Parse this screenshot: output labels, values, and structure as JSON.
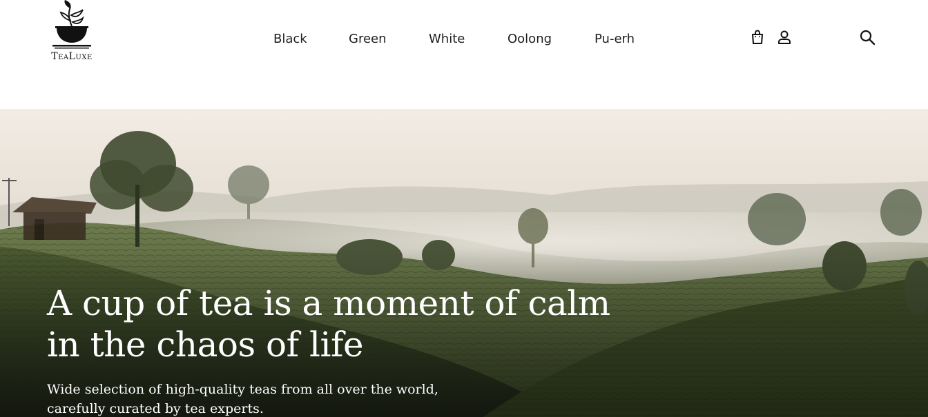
{
  "brand": {
    "name": "TeaLuxe"
  },
  "nav": {
    "items": [
      {
        "label": "Black"
      },
      {
        "label": "Green"
      },
      {
        "label": "White"
      },
      {
        "label": "Oolong"
      },
      {
        "label": "Pu-erh"
      }
    ]
  },
  "icons": {
    "cart": "shopping-bag-icon",
    "account": "user-icon",
    "search": "search-icon"
  },
  "hero": {
    "title_line1": "A cup of tea is a moment of calm",
    "title_line2": "in the chaos of life",
    "subtitle_line1": "Wide selection of high-quality teas from all over the world,",
    "subtitle_line2": "carefully curated by tea experts."
  },
  "colors": {
    "header_bg": "#ffffff",
    "nav_text": "#1d1d1d",
    "hero_text": "#ffffff",
    "mist": "#e9e4dc",
    "hill_green": "#3f4f2c"
  }
}
